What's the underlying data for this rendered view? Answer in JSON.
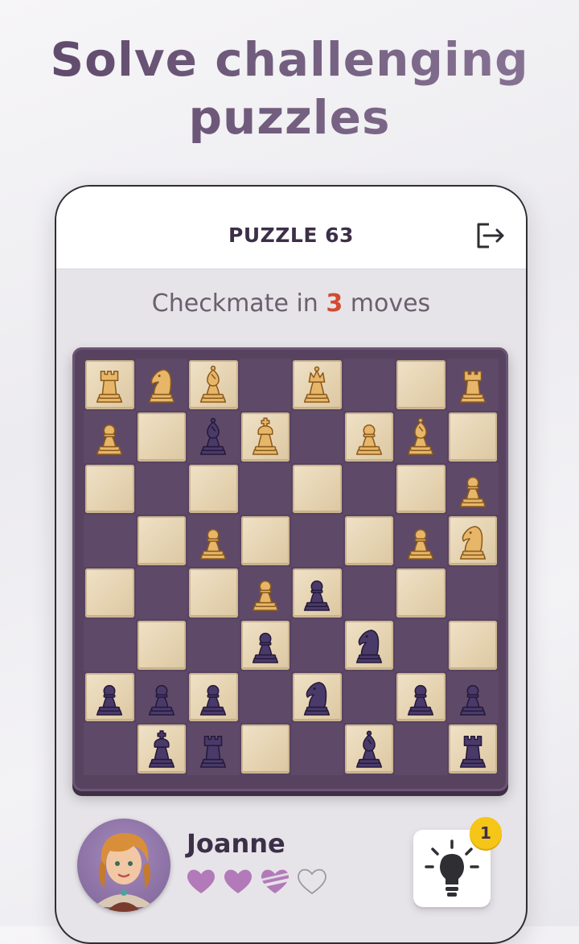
{
  "headline": {
    "line1": "Solve challenging",
    "line2": "puzzles"
  },
  "topbar": {
    "title": "PUZZLE 63",
    "exit_icon": "exit-icon"
  },
  "subtitle": {
    "prefix": "Checkmate in ",
    "number": "3",
    "suffix": " moves"
  },
  "board": {
    "rows": [
      [
        "wR",
        "wN",
        "wB",
        "",
        "wQ",
        "",
        "",
        "wR"
      ],
      [
        "wP",
        "",
        "bB",
        "wK",
        "",
        "wP",
        "wB",
        ""
      ],
      [
        "",
        "",
        "",
        "",
        "",
        "",
        "",
        "wP"
      ],
      [
        "",
        "",
        "wP",
        "",
        "",
        "",
        "wP",
        "wN"
      ],
      [
        "",
        "",
        "",
        "wP",
        "bP",
        "",
        "",
        ""
      ],
      [
        "",
        "",
        "",
        "bP",
        "",
        "bN",
        "",
        ""
      ],
      [
        "bP",
        "bP",
        "bP",
        "",
        "bN",
        "",
        "bP",
        "bP"
      ],
      [
        "",
        "bK",
        "bR",
        "",
        "",
        "bB",
        "",
        "bR"
      ]
    ],
    "colors": {
      "white_piece": "#e7b668",
      "black_piece": "#4a3a6a"
    }
  },
  "player": {
    "name": "Joanne",
    "lives": 2.5,
    "max_lives": 4,
    "heart_color": "#b27ab9"
  },
  "hint": {
    "count": "1",
    "icon": "lightbulb-icon"
  }
}
